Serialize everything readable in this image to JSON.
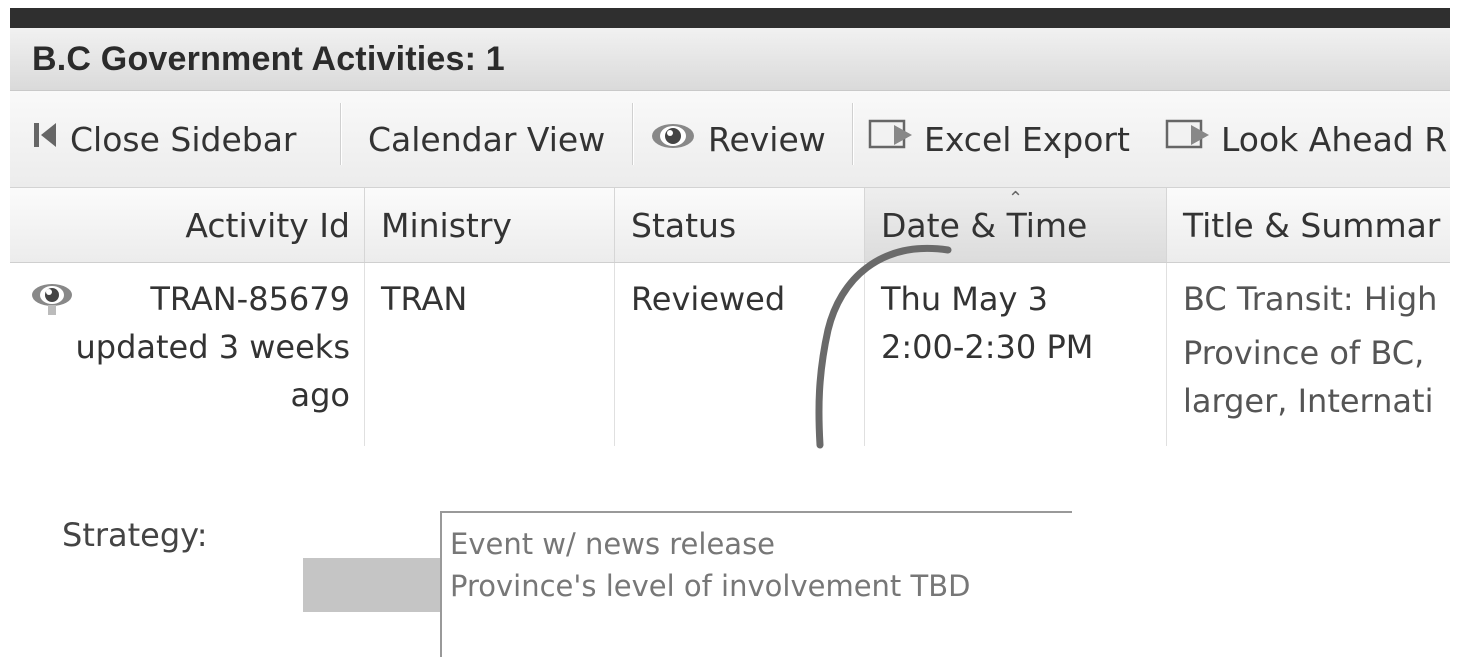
{
  "panel": {
    "title": "B.C Government Activities: 1"
  },
  "toolbar": {
    "close_sidebar": "Close Sidebar",
    "calendar_view": "Calendar View",
    "review": "Review",
    "excel_export": "Excel Export",
    "look_ahead": "Look Ahead R"
  },
  "columns": [
    "Activity Id",
    "Ministry",
    "Status",
    "Date & Time",
    "Title & Summar"
  ],
  "sort": {
    "column": "Date & Time",
    "direction": "ascending"
  },
  "row": {
    "activity_id": "TRAN-85679",
    "updated_line1": "updated 3 weeks",
    "updated_line2": "ago",
    "ministry": "TRAN",
    "status": "Reviewed",
    "date": "Thu May 3",
    "time": "2:00-2:30 PM",
    "title": "BC Transit: High",
    "summary_line1": "Province of BC,",
    "summary_line2": "larger, Internati"
  },
  "strategy": {
    "label": "Strategy:",
    "line1": "Event w/ news release",
    "line2": "Province's level of involvement TBD"
  },
  "icons": {
    "close_sidebar": "first-page-icon",
    "review": "eye-icon",
    "excel_export": "export-icon",
    "look_ahead": "export-icon",
    "row_review": "eye-icon"
  },
  "colors": {
    "header_bg": "#e4e4e4",
    "highlight": "#a0a0a0"
  }
}
